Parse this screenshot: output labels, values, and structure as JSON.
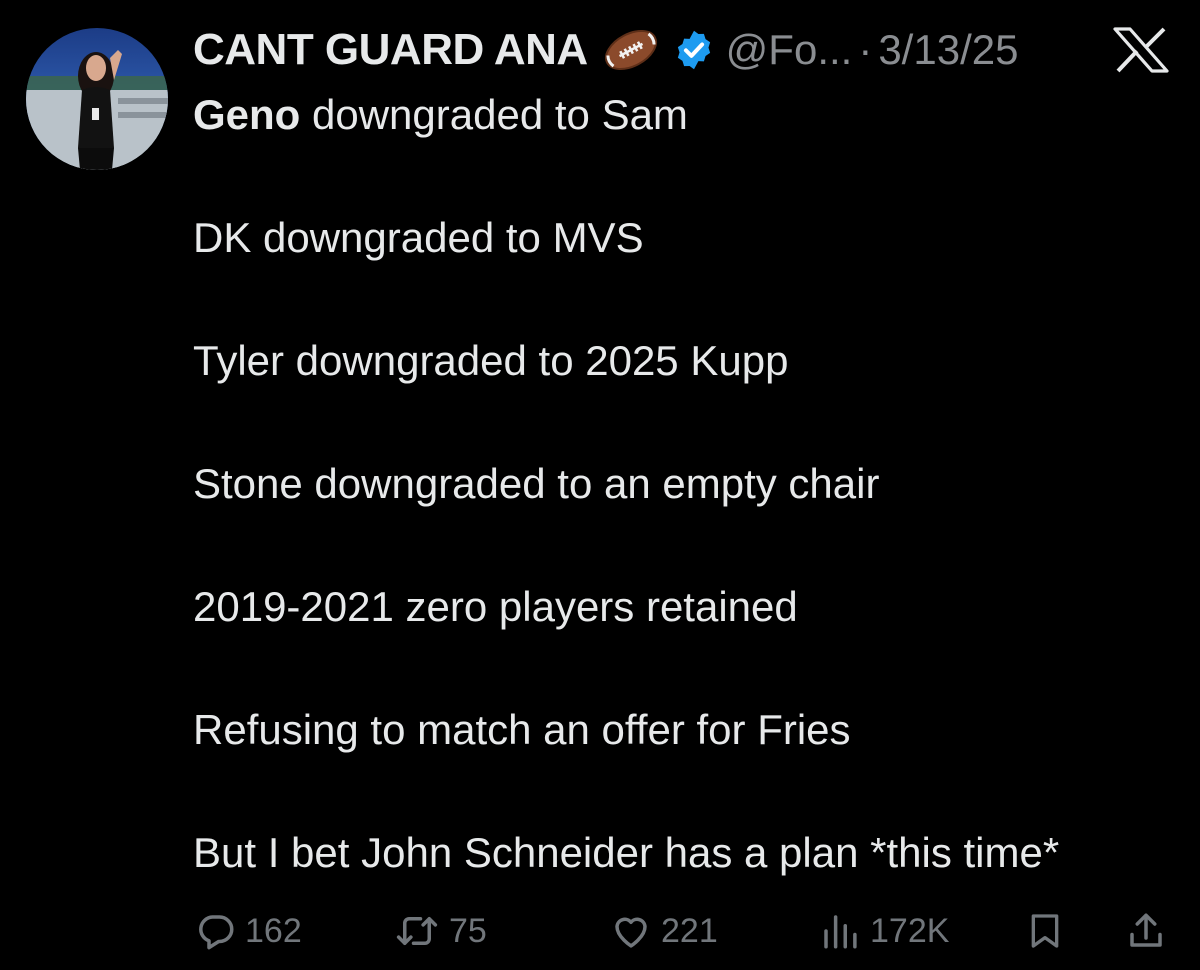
{
  "tweet": {
    "display_name": "CANT GUARD ANA",
    "handle": "@Fo...",
    "separator": "·",
    "date": "3/13/25",
    "name_emoji": "football-icon",
    "badge": "verified-icon",
    "platform_logo": "x-logo-icon",
    "lines": [
      {
        "mention": "Geno",
        "text": " downgraded to Sam"
      },
      {
        "text": "DK downgraded to MVS"
      },
      {
        "text": "Tyler downgraded to 2025 Kupp"
      },
      {
        "text": "Stone downgraded to an empty chair"
      },
      {
        "text": "2019-2021 zero players retained"
      },
      {
        "text": "Refusing to match an offer for Fries"
      },
      {
        "text": "But I bet John Schneider has a plan *this time*"
      }
    ]
  },
  "actions": {
    "replies": "162",
    "reposts": "75",
    "likes": "221",
    "views": "172K"
  },
  "colors": {
    "background": "#000000",
    "text": "#e7e9ea",
    "muted": "#71767b",
    "verified": "#1d9bf0"
  }
}
